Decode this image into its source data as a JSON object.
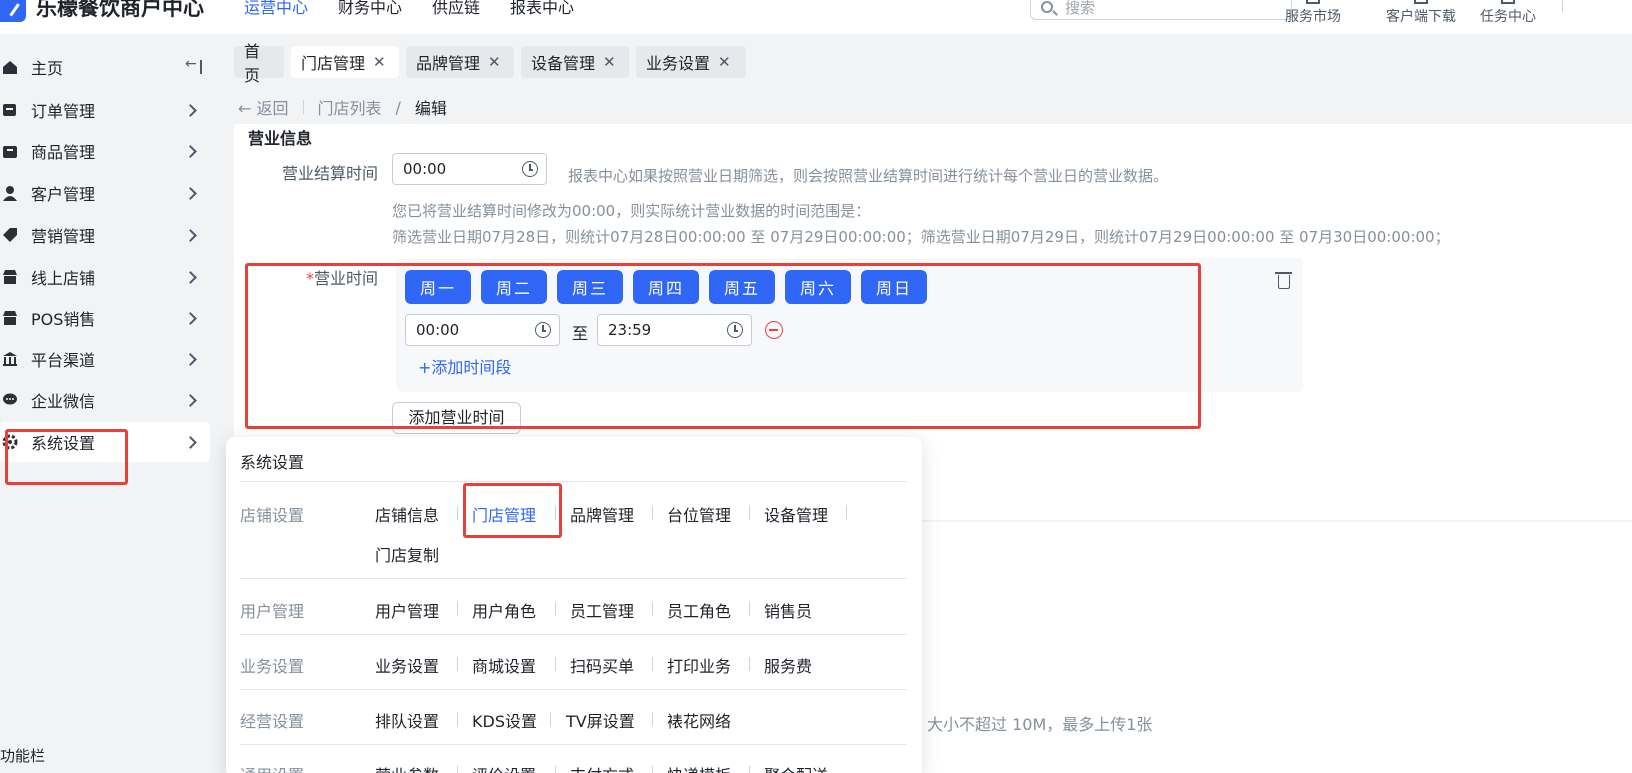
{
  "header": {
    "brand": "乐檬餐饮商户中心",
    "nav": [
      {
        "label": "运营中心",
        "active": true
      },
      {
        "label": "财务中心",
        "active": false
      },
      {
        "label": "供应链",
        "active": false
      },
      {
        "label": "报表中心",
        "active": false
      }
    ],
    "search_placeholder": "搜索",
    "links": [
      "服务市场",
      "客户端下载",
      "任务中心"
    ]
  },
  "sidebar": {
    "items": [
      {
        "label": "主页",
        "icon": "home-icon"
      },
      {
        "label": "订单管理",
        "icon": "order-icon"
      },
      {
        "label": "商品管理",
        "icon": "goods-icon"
      },
      {
        "label": "客户管理",
        "icon": "user-icon"
      },
      {
        "label": "营销管理",
        "icon": "tag-icon"
      },
      {
        "label": "线上店铺",
        "icon": "store-icon"
      },
      {
        "label": "POS销售",
        "icon": "pos-icon"
      },
      {
        "label": "平台渠道",
        "icon": "bank-icon"
      },
      {
        "label": "企业微信",
        "icon": "chat-icon"
      },
      {
        "label": "系统设置",
        "icon": "gear-icon"
      }
    ],
    "footer": "功能栏"
  },
  "tabs": [
    {
      "label": "首页",
      "closable": false
    },
    {
      "label": "门店管理",
      "closable": true,
      "active": true
    },
    {
      "label": "品牌管理",
      "closable": true
    },
    {
      "label": "设备管理",
      "closable": true
    },
    {
      "label": "业务设置",
      "closable": true
    }
  ],
  "breadcrumb": {
    "back": "返回",
    "parent": "门店列表",
    "sep": "/",
    "current": "编辑"
  },
  "form": {
    "section_title": "营业信息",
    "settle_label": "营业结算时间",
    "settle_value": "00:00",
    "settle_hint": "报表中心如果按照营业日期筛选，则会按照营业结算时间进行统计每个营业日的营业数据。",
    "settle_note1": "您已将营业结算时间修改为00:00，则实际统计营业数据的时间范围是：",
    "settle_note2": "筛选营业日期07月28日，则统计07月28日00:00:00 至 07月29日00:00:00；筛选营业日期07月29日，则统计07月29日00:00:00 至 07月30日00:00:00；",
    "hours_label": "营业时间",
    "required_mark": "*",
    "days": [
      "周一",
      "周二",
      "周三",
      "周四",
      "周五",
      "周六",
      "周日"
    ],
    "start_time": "00:00",
    "to": "至",
    "end_time": "23:59",
    "add_period": "+添加时间段",
    "add_hours": "添加营业时间",
    "upload_hint": "大小不超过 10M，最多上传1张"
  },
  "popup": {
    "title": "系统设置",
    "groups": [
      {
        "label": "店铺设置",
        "items": [
          "店铺信息",
          "门店管理",
          "品牌管理",
          "台位管理",
          "设备管理",
          "门店复制"
        ],
        "active": "门店管理"
      },
      {
        "label": "用户管理",
        "items": [
          "用户管理",
          "用户角色",
          "员工管理",
          "员工角色",
          "销售员"
        ]
      },
      {
        "label": "业务设置",
        "items": [
          "业务设置",
          "商城设置",
          "扫码买单",
          "打印业务",
          "服务费"
        ]
      },
      {
        "label": "经营设置",
        "items": [
          "排队设置",
          "KDS设置",
          "TV屏设置",
          "裱花网络"
        ]
      },
      {
        "label": "通用设置",
        "items": [
          "营业参数",
          "评价设置",
          "支付方式",
          "快递模板",
          "聚合配送"
        ]
      }
    ]
  },
  "colors": {
    "accent": "#2f66f6",
    "highlight": "#e8413c",
    "danger": "#f53f3f"
  }
}
